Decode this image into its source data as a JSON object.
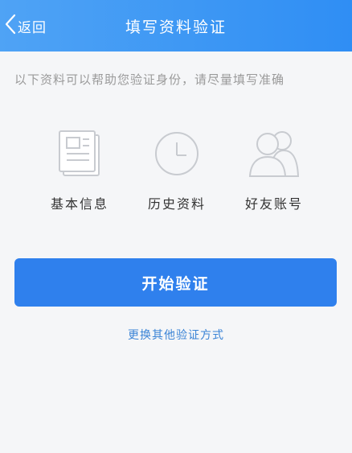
{
  "header": {
    "back_label": "返回",
    "title": "填写资料验证"
  },
  "hint_text": "以下资料可以帮助您验证身份，请尽量填写准确",
  "options": [
    {
      "label": "基本信息",
      "icon": "document-icon"
    },
    {
      "label": "历史资料",
      "icon": "clock-icon"
    },
    {
      "label": "好友账号",
      "icon": "friends-icon"
    }
  ],
  "start_button_label": "开始验证",
  "alt_link_label": "更换其他验证方式",
  "colors": {
    "header": "#2f8ef4",
    "button": "#2f80ed",
    "link": "#3b84d6",
    "icon": "#c8cbd0"
  }
}
